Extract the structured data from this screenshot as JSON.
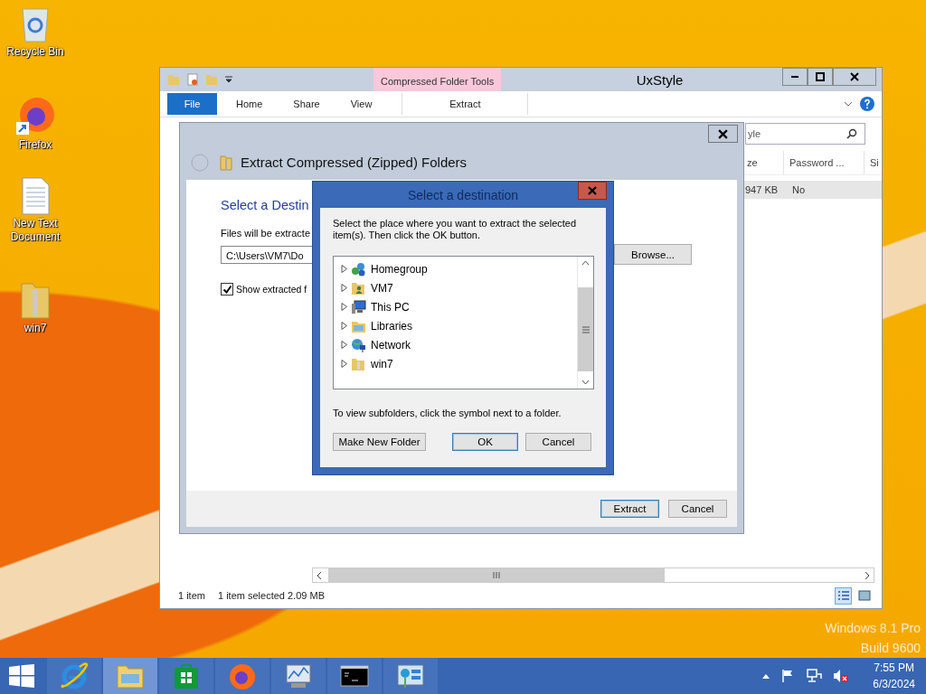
{
  "desktop_icons": [
    {
      "label": "Recycle Bin",
      "kind": "recycle"
    },
    {
      "label": "Firefox",
      "kind": "firefox"
    },
    {
      "label": "New Text Document",
      "kind": "text"
    },
    {
      "label": "win7",
      "kind": "zip"
    }
  ],
  "os_watermark": [
    "Windows 8.1 Pro",
    "Build 9600"
  ],
  "explorer": {
    "title": "UxStyle",
    "context_group": "Compressed Folder Tools",
    "ribbon_tabs": [
      {
        "label": "File",
        "kind": "file",
        "selected": false
      },
      {
        "label": "Home",
        "kind": "tab",
        "selected": false
      },
      {
        "label": "Share",
        "kind": "tab",
        "selected": false
      },
      {
        "label": "View",
        "kind": "tab",
        "selected": false
      },
      {
        "label": "Extract",
        "kind": "context",
        "selected": false
      }
    ],
    "search_value": "yle",
    "columns": [
      "ze",
      "Password ...",
      "Si"
    ],
    "row": [
      "947 KB",
      "No"
    ],
    "status": [
      "1 item",
      "1 item selected  2.09 MB"
    ],
    "views": [
      {
        "kind": "details",
        "selected": true
      },
      {
        "kind": "tiles",
        "selected": false
      }
    ]
  },
  "extract_dialog": {
    "title": "Extract Compressed (Zipped) Folders",
    "heading": "Select a Destin",
    "path_label": "Files will be extracte",
    "path_value": "C:\\Users\\VM7\\Do",
    "browse": "Browse...",
    "show_checkbox": {
      "label": "Show extracted f",
      "checked": true
    },
    "buttons": [
      {
        "label": "Extract",
        "default": true
      },
      {
        "label": "Cancel",
        "default": false
      }
    ]
  },
  "browse_dialog": {
    "title": "Select a destination",
    "instructions": "Select the place where you want to extract the selected item(s).  Then click the OK button.",
    "tree": [
      {
        "label": "Homegroup",
        "kind": "homegroup",
        "expanded": false
      },
      {
        "label": "VM7",
        "kind": "user",
        "expanded": false
      },
      {
        "label": "This PC",
        "kind": "pc",
        "expanded": false
      },
      {
        "label": "Libraries",
        "kind": "libraries",
        "expanded": false
      },
      {
        "label": "Network",
        "kind": "network",
        "expanded": false
      },
      {
        "label": "win7",
        "kind": "folder",
        "expanded": false
      }
    ],
    "hint": "To view subfolders, click the symbol next to a folder.",
    "buttons": [
      {
        "label": "Make New Folder",
        "default": false
      },
      {
        "label": "OK",
        "default": true
      },
      {
        "label": "Cancel",
        "default": false
      }
    ]
  },
  "taskbar": {
    "apps": [
      {
        "kind": "ie",
        "active": false
      },
      {
        "kind": "explorer",
        "active": true
      },
      {
        "kind": "store",
        "active": false
      },
      {
        "kind": "firefox",
        "active": false
      },
      {
        "kind": "perfmon",
        "active": false
      },
      {
        "kind": "cmd",
        "active": false
      },
      {
        "kind": "control",
        "active": false
      }
    ],
    "time": "7:55 PM",
    "date": "6/3/2024"
  }
}
